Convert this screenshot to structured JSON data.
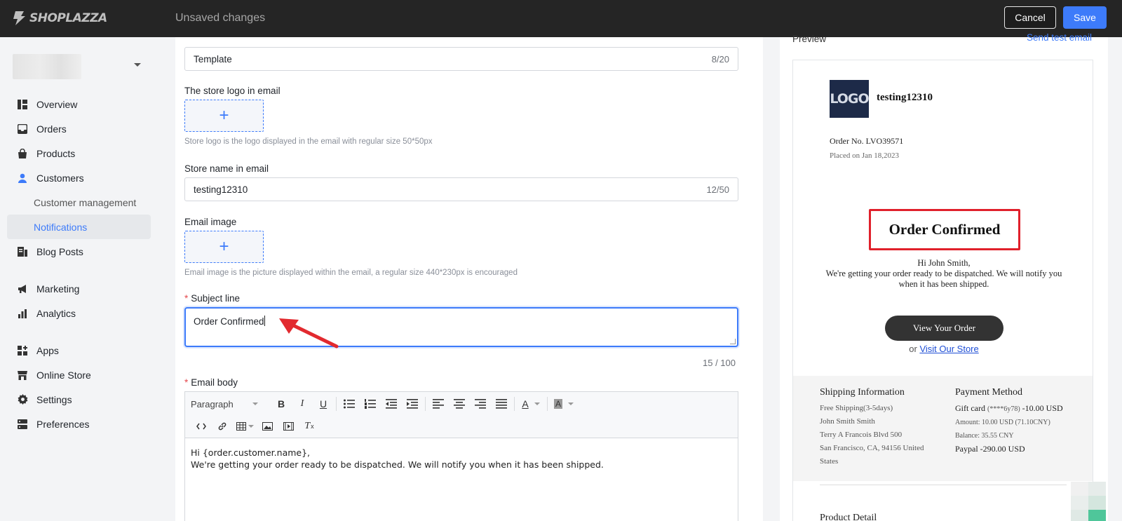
{
  "topbar": {
    "brand": "SHOPLAZZA",
    "status": "Unsaved changes",
    "cancel_label": "Cancel",
    "save_label": "Save"
  },
  "sidebar": {
    "items": [
      {
        "label": "Overview",
        "icon": "overview-icon"
      },
      {
        "label": "Orders",
        "icon": "orders-icon"
      },
      {
        "label": "Products",
        "icon": "products-icon"
      },
      {
        "label": "Customers",
        "icon": "customers-icon"
      },
      {
        "label": "Customer management"
      },
      {
        "label": "Notifications"
      },
      {
        "label": "Blog Posts",
        "icon": "blog-icon"
      },
      {
        "label": "Marketing",
        "icon": "marketing-icon"
      },
      {
        "label": "Analytics",
        "icon": "analytics-icon"
      },
      {
        "label": "Apps",
        "icon": "apps-icon"
      },
      {
        "label": "Online Store",
        "icon": "store-icon"
      },
      {
        "label": "Settings",
        "icon": "gear-icon"
      },
      {
        "label": "Preferences",
        "icon": "preferences-icon"
      }
    ]
  },
  "form": {
    "template_title": {
      "value": "Template",
      "counter": "8/20"
    },
    "store_logo": {
      "label": "The store logo in email",
      "hint": "Store logo is the logo displayed in the email with regular size 50*50px"
    },
    "store_name": {
      "label": "Store name in email",
      "value": "testing12310",
      "counter": "12/50"
    },
    "email_image": {
      "label": "Email image",
      "hint": "Email image is the picture displayed within the email, a regular size 440*230px is encouraged"
    },
    "subject": {
      "label": "Subject line",
      "value": "Order Confirmed",
      "counter": "15 / 100"
    },
    "body": {
      "label": "Email body",
      "format": "Paragraph",
      "line1": "Hi {order.customer.name},",
      "line2": "We're getting your order ready to be dispatched. We will notify you when it has been shipped."
    }
  },
  "preview": {
    "label": "Preview",
    "send_test": "Send test email",
    "logo_text": "LOGO",
    "store_name": "testing12310",
    "order_no": "Order No. LVO39571",
    "placed_on": "Placed on Jan 18,2023",
    "heading": "Order Confirmed",
    "greeting": "Hi John Smith,",
    "message": "We're getting your order ready to be dispatched. We will notify you when it has been shipped.",
    "view_button": "View Your Order",
    "or": "or",
    "visit_link": "Visit Our Store",
    "shipping": {
      "title": "Shipping Information",
      "method": "Free Shipping(3-5days)",
      "name": "John Smith Smith",
      "address1": "Terry A Francois Blvd 500",
      "address2": "San Francisco, CA, 94156 United States"
    },
    "payment": {
      "title": "Payment Method",
      "gift_card": "Gift card",
      "gift_code": "(****6y78)",
      "gift_amount": "-10.00 USD",
      "amount": "Amount:  10.00 USD  (71.10CNY)",
      "balance": "Balance:  35.55 CNY",
      "paypal": "Paypal",
      "paypal_amount": "-290.00 USD"
    },
    "product_detail": "Product Detail"
  },
  "colors": {
    "accent": "#3d7bfa",
    "topbar": "#252525",
    "highlight": "#e0202b"
  }
}
